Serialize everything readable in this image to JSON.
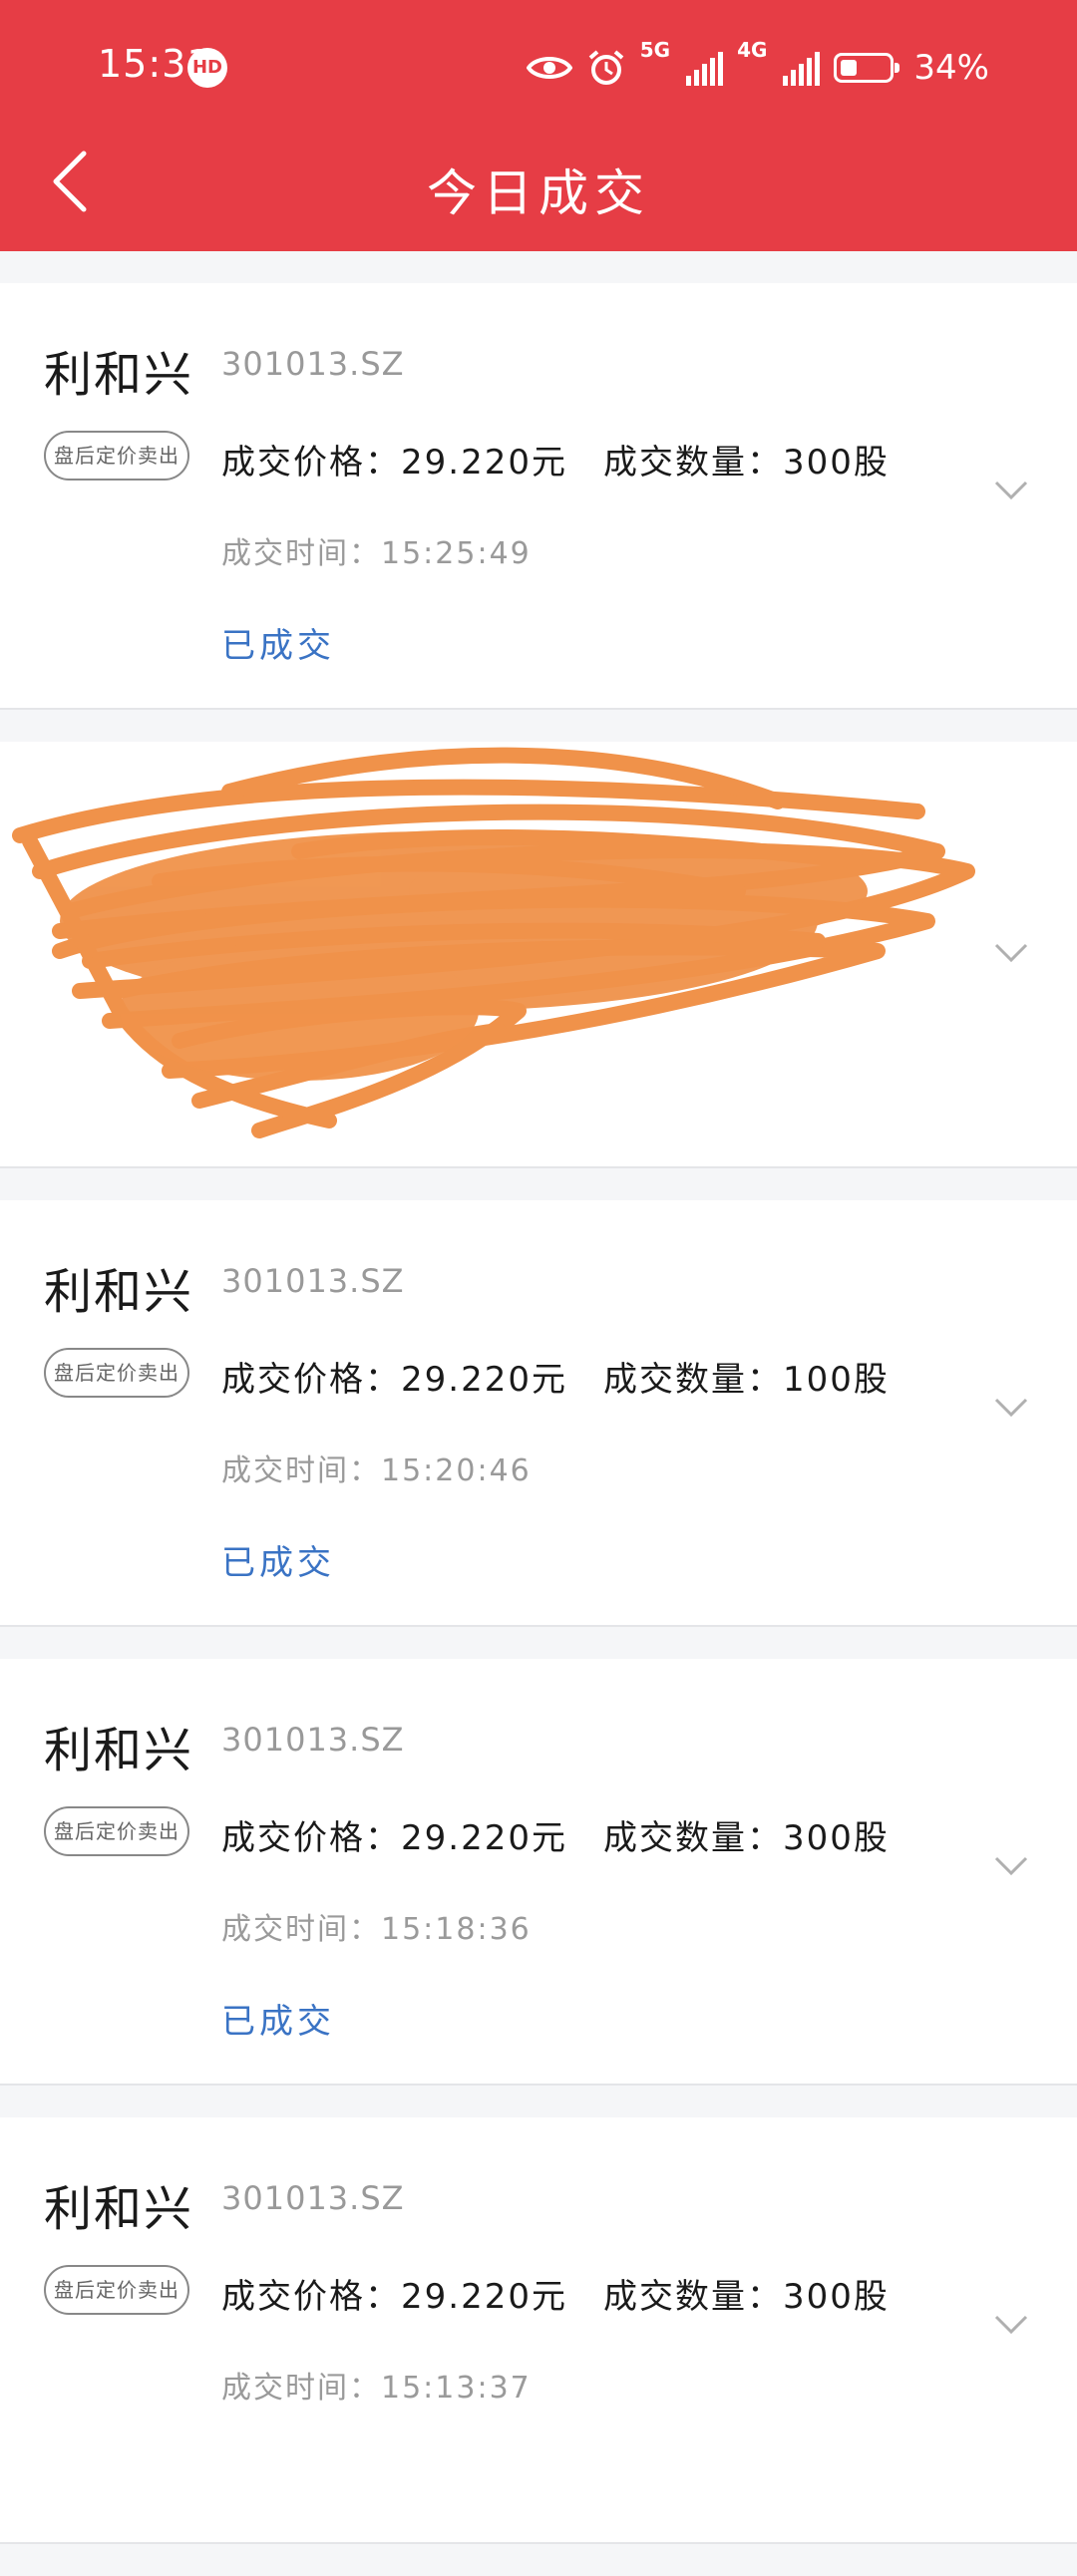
{
  "status_bar": {
    "time": "15:31",
    "hd_badge": "HD",
    "battery_percent": "34%",
    "network_1": "5G",
    "network_2": "4G"
  },
  "header": {
    "title": "今日成交",
    "back_icon": "chevron-left-icon"
  },
  "labels": {
    "price_prefix": "成交价格：",
    "qty_prefix": "成交数量：",
    "time_prefix": "成交时间：",
    "price_unit": "元",
    "qty_unit": "股"
  },
  "colors": {
    "header_bg": "#e63d45",
    "status_blue": "#3a73c4",
    "redaction_orange": "#f0924a"
  },
  "trades": [
    {
      "name": "利和兴",
      "code": "301013.SZ",
      "type": "盘后定价卖出",
      "price": "29.220",
      "quantity": "300",
      "time": "15:25:49",
      "status": "已成交"
    },
    {
      "redacted": true
    },
    {
      "name": "利和兴",
      "code": "301013.SZ",
      "type": "盘后定价卖出",
      "price": "29.220",
      "quantity": "100",
      "time": "15:20:46",
      "status": "已成交"
    },
    {
      "name": "利和兴",
      "code": "301013.SZ",
      "type": "盘后定价卖出",
      "price": "29.220",
      "quantity": "300",
      "time": "15:18:36",
      "status": "已成交"
    },
    {
      "name": "利和兴",
      "code": "301013.SZ",
      "type": "盘后定价卖出",
      "price": "29.220",
      "quantity": "300",
      "time": "15:13:37",
      "status": ""
    }
  ]
}
